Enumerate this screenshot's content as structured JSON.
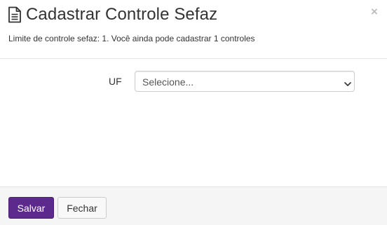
{
  "modal": {
    "title": "Cadastrar Controle Sefaz",
    "title_icon": "document-icon",
    "close_symbol": "×",
    "subtitle": "Limite de controle sefaz: 1. Você ainda pode cadastrar 1 controles"
  },
  "form": {
    "uf_label": "UF",
    "uf_select_value": "Selecione..."
  },
  "footer": {
    "save_label": "Salvar",
    "close_label": "Fechar"
  },
  "colors": {
    "primary": "#5b2a8c",
    "footer_bg": "#f5f5f5",
    "close_icon": "#bdbdbd"
  }
}
